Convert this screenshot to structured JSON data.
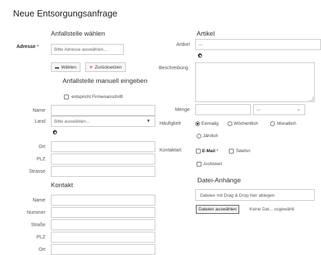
{
  "page_title": "Neue Entsorgungsanfrage",
  "left": {
    "section_title": "Anfallstelle wählen",
    "address_label": "Adresse",
    "required_mark": "*",
    "address_placeholder": "Bitte Adresse auswählen...",
    "choose_button": "Wählen",
    "reset_button": "Zurücksetzen",
    "manual_title": "Anfallstelle manuell eingeben",
    "company_address_checkbox": "entspricht Firmenanschrift",
    "fields": {
      "name": "Name",
      "land": "Land",
      "land_placeholder": "Bitte auswählen...",
      "ort": "Ort",
      "plz": "PLZ",
      "strasse": "Strasse"
    },
    "contact_title": "Kontakt",
    "contact_fields": [
      "Name",
      "Nummer",
      "Straße",
      "PLZ",
      "Ort"
    ]
  },
  "right": {
    "section_title": "Artikel",
    "artikel_label": "Artikel",
    "artikel_value": "---",
    "description_label": "Beschreibung",
    "menge_label": "Menge",
    "unit_value": "---",
    "frequency_label": "Häufigkeit",
    "frequency_options": [
      {
        "label": "Einmalig",
        "checked": true
      },
      {
        "label": "Wöchentlich",
        "checked": false
      },
      {
        "label": "Monatlich",
        "checked": false
      },
      {
        "label": "Jährlich",
        "checked": false
      }
    ],
    "contact_label": "Kontaktart",
    "email_option": "E-Mail",
    "required_mark": "*",
    "phone_option": "Telefon",
    "archived_option": "Archiviert",
    "attachments_title": "Datei-Anhänge",
    "dropzone_text": "Dateien mit Drag & Drop hier ablegen",
    "file_button": "Dateien auswählen",
    "file_status": "Keine Dat... usgewählt"
  },
  "colors": {
    "required": "#d9534f",
    "border": "#c8c8c8"
  }
}
